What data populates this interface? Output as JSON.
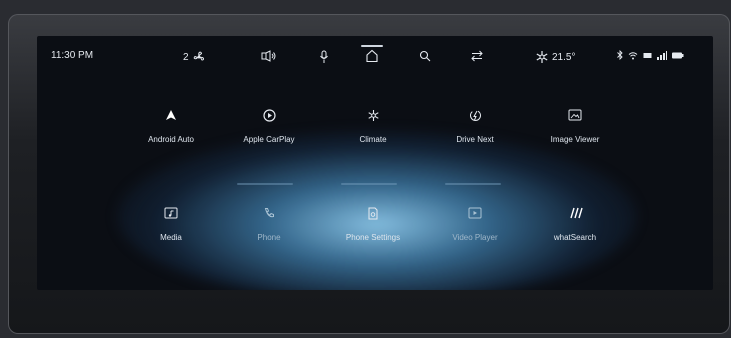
{
  "status": {
    "time": "11:30 PM",
    "fan_speed": "2",
    "temperature": "21.5°"
  },
  "apps": [
    {
      "label": "Android Auto",
      "icon": "android-auto-icon"
    },
    {
      "label": "Apple CarPlay",
      "icon": "play-icon"
    },
    {
      "label": "Climate",
      "icon": "snowflake-icon"
    },
    {
      "label": "Drive Next",
      "icon": "drive-icon"
    },
    {
      "label": "Image Viewer",
      "icon": "image-icon"
    },
    {
      "label": "Media",
      "icon": "media-icon"
    },
    {
      "label": "Phone",
      "icon": "phone-icon"
    },
    {
      "label": "Phone Settings",
      "icon": "phone-settings-icon"
    },
    {
      "label": "Video Player",
      "icon": "video-icon"
    },
    {
      "label": "whatSearch",
      "icon": "search-slash-icon"
    }
  ]
}
